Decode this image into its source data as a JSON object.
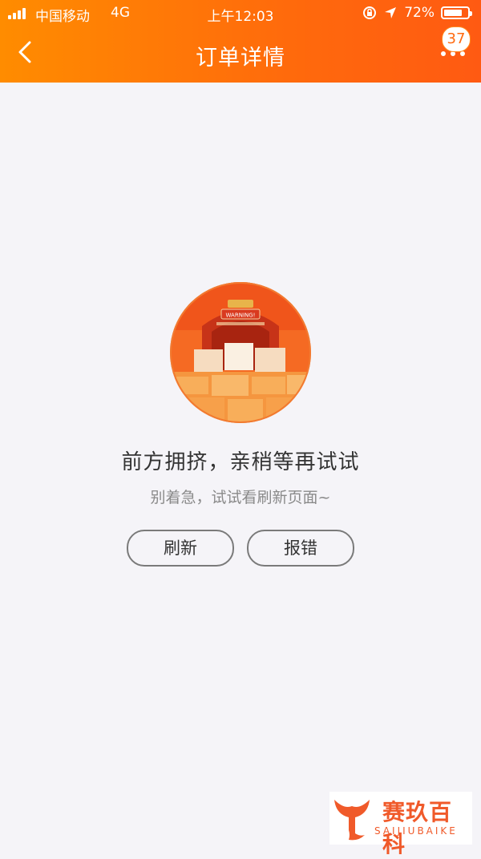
{
  "status_bar": {
    "carrier": "中国移动",
    "network": "4G",
    "time": "上午12:03",
    "battery": "72%"
  },
  "nav": {
    "title": "订单详情",
    "badge": "37"
  },
  "illustration": {
    "sign": "WARNING!"
  },
  "error": {
    "title": "前方拥挤，亲稍等再试试",
    "subtitle": "别着急，试试看刷新页面~"
  },
  "buttons": {
    "refresh": "刷新",
    "report": "报错"
  },
  "watermark": {
    "cn": "赛玖百科",
    "en": "SAIJIUBAIKE"
  },
  "colors": {
    "header_start": "#ff8a00",
    "header_end": "#ff5a10",
    "background": "#f5f4f8",
    "illustration": "#f56a23"
  }
}
